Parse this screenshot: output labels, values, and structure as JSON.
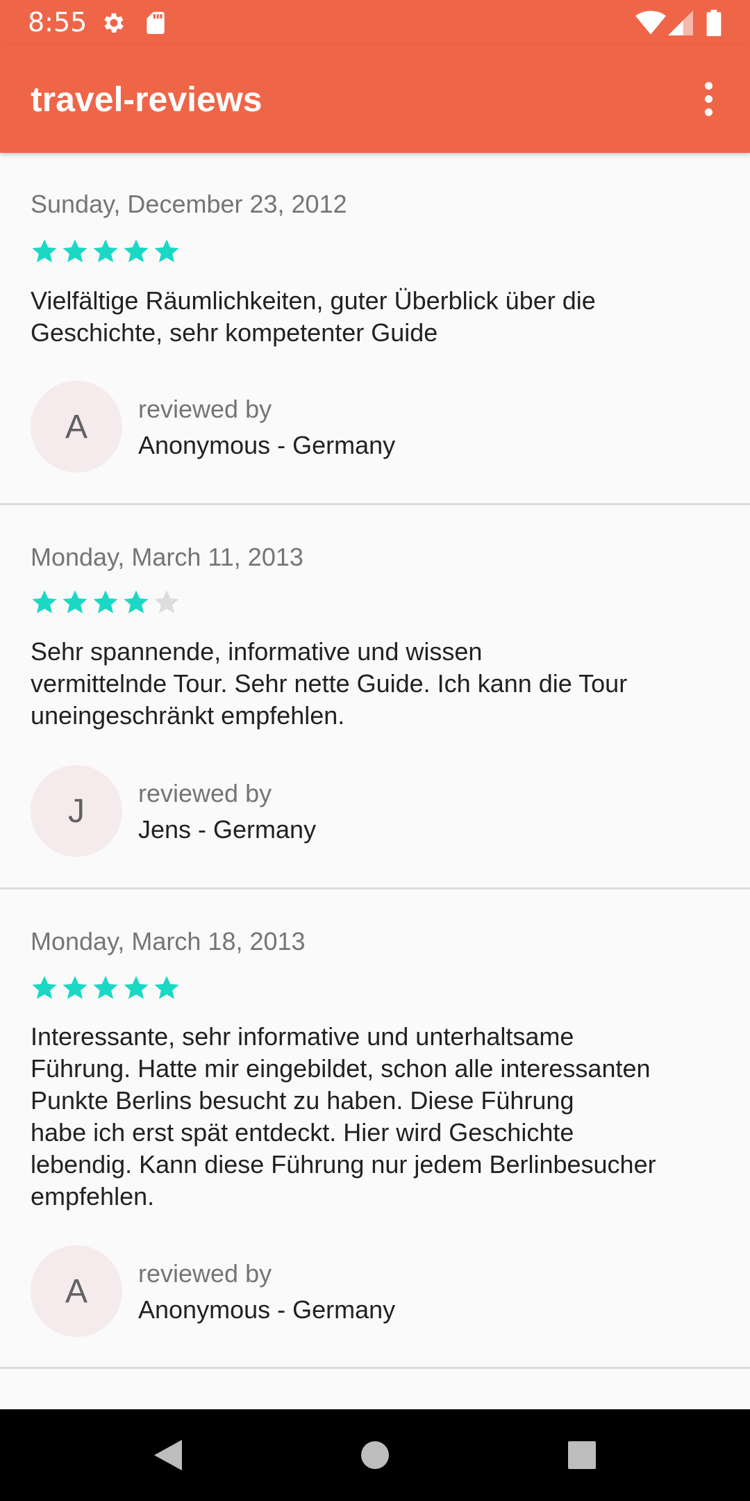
{
  "status_bar": {
    "time": "8:55",
    "left_icons": [
      "gear-icon",
      "sd-card-icon"
    ],
    "right_icons": [
      "wifi-icon",
      "cell-signal-icon",
      "battery-icon"
    ],
    "background": "#ef6548"
  },
  "app_bar": {
    "title": "travel-reviews",
    "menu_icon": "more-vert-icon",
    "background": "#ef6548"
  },
  "colors": {
    "star_filled": "#1ad8c4",
    "star_empty": "#dddddd",
    "avatar_bg": "#f5eaec"
  },
  "reviews": [
    {
      "date": "Sunday, December 23, 2012",
      "rating": 5,
      "max_rating": 5,
      "text": "Vielfältige Räumlichkeiten, guter Überblick über die\nGeschichte, sehr kompetenter Guide",
      "avatar_initial": "A",
      "reviewed_by_label": "reviewed by",
      "reviewer": "Anonymous - Germany"
    },
    {
      "date": "Monday, March 11, 2013",
      "rating": 4,
      "max_rating": 5,
      "text": "Sehr spannende, informative und wissen\nvermittelnde Tour. Sehr nette Guide. Ich kann die Tour\nuneingeschränkt empfehlen.",
      "avatar_initial": "J",
      "reviewed_by_label": "reviewed by",
      "reviewer": "Jens - Germany"
    },
    {
      "date": "Monday, March 18, 2013",
      "rating": 5,
      "max_rating": 5,
      "text": "Interessante, sehr informative und unterhaltsame\nFührung. Hatte mir eingebildet, schon alle interessanten\nPunkte Berlins besucht zu haben. Diese Führung\nhabe ich erst spät entdeckt. Hier wird Geschichte\nlebendig. Kann diese Führung nur jedem Berlinbesucher\nempfehlen.",
      "avatar_initial": "A",
      "reviewed_by_label": "reviewed by",
      "reviewer": "Anonymous - Germany"
    }
  ],
  "nav_bar": {
    "buttons": [
      "back-icon",
      "home-icon",
      "recents-icon"
    ]
  }
}
